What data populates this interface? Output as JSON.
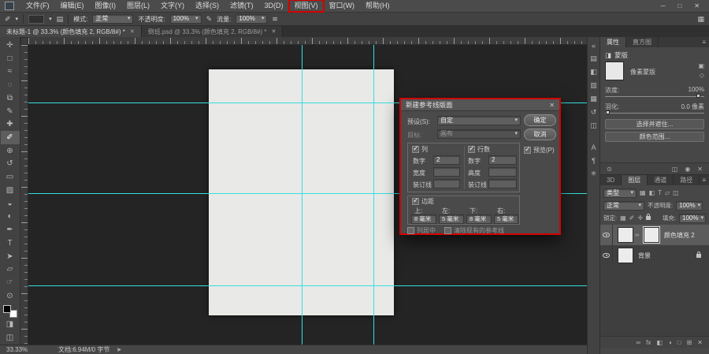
{
  "colors": {
    "annotation_red": "#d40000",
    "guide_cyan": "#35dfdf"
  },
  "icons": {
    "dropdown": "▾",
    "close": "✕",
    "menu": "≡",
    "chevron": "▶"
  },
  "window": {
    "minimize": "─",
    "maximize": "□",
    "close": "✕"
  },
  "menubar": {
    "items": [
      "文件(F)",
      "编辑(E)",
      "图像(I)",
      "图层(L)",
      "文字(Y)",
      "选择(S)",
      "滤镜(T)",
      "3D(D)",
      "视图(V)",
      "窗口(W)",
      "帮助(H)"
    ]
  },
  "options_bar": {
    "tool_icon": "✐",
    "panel_toggle_icon": "▤",
    "mode_label": "模式:",
    "mode_value": "正常",
    "opacity_label": "不透明度:",
    "opacity_value": "100%",
    "pressure_icon": "✎",
    "flow_label": "流量:",
    "flow_value": "100%",
    "airbrush_icon": "≋",
    "workspace_icon": "▦"
  },
  "tabs": [
    {
      "label": "未标题-1 @ 33.3% (颜色填充 2, RGB/8#) *"
    },
    {
      "label": "倒班.psd @ 33.3% (颜色填充 2, RGB/8#) *"
    }
  ],
  "toolbar": {
    "tools": [
      {
        "name": "move",
        "glyph": "✛"
      },
      {
        "name": "marquee",
        "glyph": "□"
      },
      {
        "name": "lasso",
        "glyph": "≈"
      },
      {
        "name": "quick-selection",
        "glyph": "◌"
      },
      {
        "name": "crop",
        "glyph": "⧉"
      },
      {
        "name": "eyedropper",
        "glyph": "✎"
      },
      {
        "name": "healing-brush",
        "glyph": "✚"
      },
      {
        "name": "brush",
        "glyph": "✐"
      },
      {
        "name": "clone-stamp",
        "glyph": "⊕"
      },
      {
        "name": "history-brush",
        "glyph": "↺"
      },
      {
        "name": "eraser",
        "glyph": "▭"
      },
      {
        "name": "gradient",
        "glyph": "▨"
      },
      {
        "name": "blur",
        "glyph": "◒"
      },
      {
        "name": "dodge",
        "glyph": "◐"
      },
      {
        "name": "pen",
        "glyph": "✒"
      },
      {
        "name": "type",
        "glyph": "T"
      },
      {
        "name": "path-selection",
        "glyph": "➤"
      },
      {
        "name": "shape",
        "glyph": "▱"
      },
      {
        "name": "hand",
        "glyph": "☞"
      },
      {
        "name": "zoom",
        "glyph": "⊙"
      }
    ]
  },
  "dialog": {
    "title": "新建参考线版面",
    "preset": {
      "label": "预设(S):",
      "value": "自定"
    },
    "target": {
      "label": "目标:",
      "value": "画布"
    },
    "ok_label": "确定",
    "cancel_label": "取消",
    "preview_label": "预览(P)",
    "columns": {
      "label": "列",
      "number_label": "数字",
      "number_value": "2",
      "width_label": "宽度",
      "width_value": "",
      "gutter_label": "装订线",
      "gutter_value": ""
    },
    "rows": {
      "label": "行数",
      "number_label": "数字",
      "number_value": "2",
      "height_label": "高度",
      "height_value": "",
      "gutter_label": "装订线",
      "gutter_value": ""
    },
    "margin": {
      "label": "边距",
      "top_label": "上:",
      "left_label": "左:",
      "bottom_label": "下:",
      "right_label": "右:",
      "top_value": "8 毫米",
      "left_value": "5 毫米",
      "bottom_value": "8 毫米",
      "right_value": "5 毫米"
    },
    "center_columns_label": "列居中",
    "clear_guides_label": "清除现有的参考线"
  },
  "right_dock": {
    "icons": [
      {
        "name": "collapse-panels",
        "glyph": "«"
      },
      {
        "name": "color-panel",
        "glyph": "▤"
      },
      {
        "name": "adjustments-panel",
        "glyph": "◧"
      },
      {
        "name": "libraries-panel",
        "glyph": "▥"
      },
      {
        "name": "styles-panel",
        "glyph": "▦"
      },
      {
        "name": "history-panel",
        "glyph": "↺"
      },
      {
        "name": "info-panel",
        "glyph": "◫"
      },
      {
        "name": "character-panel",
        "glyph": "A"
      },
      {
        "name": "paragraph-panel",
        "glyph": "¶"
      },
      {
        "name": "glyphs-panel",
        "glyph": "✳"
      }
    ]
  },
  "properties_panel": {
    "tabs": [
      {
        "label": "属性"
      },
      {
        "label": "直方图"
      }
    ],
    "header_icon": "◨",
    "header": "蒙版",
    "mask_label": "像素蒙版",
    "mask_buttons": [
      {
        "name": "select-pixel-mask",
        "glyph": "▣"
      },
      {
        "name": "select-vector-mask",
        "glyph": "◇"
      }
    ],
    "density_label": "浓度:",
    "density_value": "100%",
    "feather_label": "羽化:",
    "feather_value": "0.0 像素",
    "buttons": [
      {
        "label": "选择并遮住..."
      },
      {
        "label": "颜色范围..."
      }
    ],
    "bottom_icons": [
      {
        "name": "load-selection-from-mask",
        "glyph": "⊙"
      },
      {
        "name": "apply-mask",
        "glyph": "◫"
      },
      {
        "name": "disable-mask",
        "glyph": "◉"
      },
      {
        "name": "delete-mask",
        "glyph": "✕"
      }
    ]
  },
  "layers_panel": {
    "tabs": [
      {
        "label": "3D"
      },
      {
        "label": "图层"
      },
      {
        "label": "通道"
      },
      {
        "label": "路径"
      }
    ],
    "filter_label": "类型",
    "filter_icons": [
      {
        "name": "filter-pixel-layers",
        "glyph": "▦"
      },
      {
        "name": "filter-adjustment-layers",
        "glyph": "◧"
      },
      {
        "name": "filter-type-layers",
        "glyph": "T"
      },
      {
        "name": "filter-shape-layers",
        "glyph": "▱"
      },
      {
        "name": "filter-smart-objects",
        "glyph": "◫"
      }
    ],
    "blend_mode": "正常",
    "opacity_label": "不透明度:",
    "opacity_value": "100%",
    "lock_label": "锁定:",
    "lock_icons": [
      {
        "name": "lock-transparent-pixels",
        "glyph": "▦"
      },
      {
        "name": "lock-image-pixels",
        "glyph": "✐"
      },
      {
        "name": "lock-position",
        "glyph": "✛"
      }
    ],
    "fill_label": "填充:",
    "fill_value": "100%",
    "layers": [
      {
        "name": "颜色填充 2"
      },
      {
        "name": "背景"
      }
    ],
    "bottom_icons": [
      {
        "name": "link-layers",
        "glyph": "∞"
      },
      {
        "name": "layer-effects",
        "glyph": "fx"
      },
      {
        "name": "add-layer-mask",
        "glyph": "◧"
      },
      {
        "name": "new-adjustment-layer",
        "glyph": "◑"
      },
      {
        "name": "new-group",
        "glyph": "□"
      },
      {
        "name": "new-layer",
        "glyph": "⊞"
      },
      {
        "name": "delete-layer",
        "glyph": "✕"
      }
    ]
  },
  "status_bar": {
    "zoom": "33.33%",
    "doc_info": "文档:6.94M/0 字节"
  }
}
